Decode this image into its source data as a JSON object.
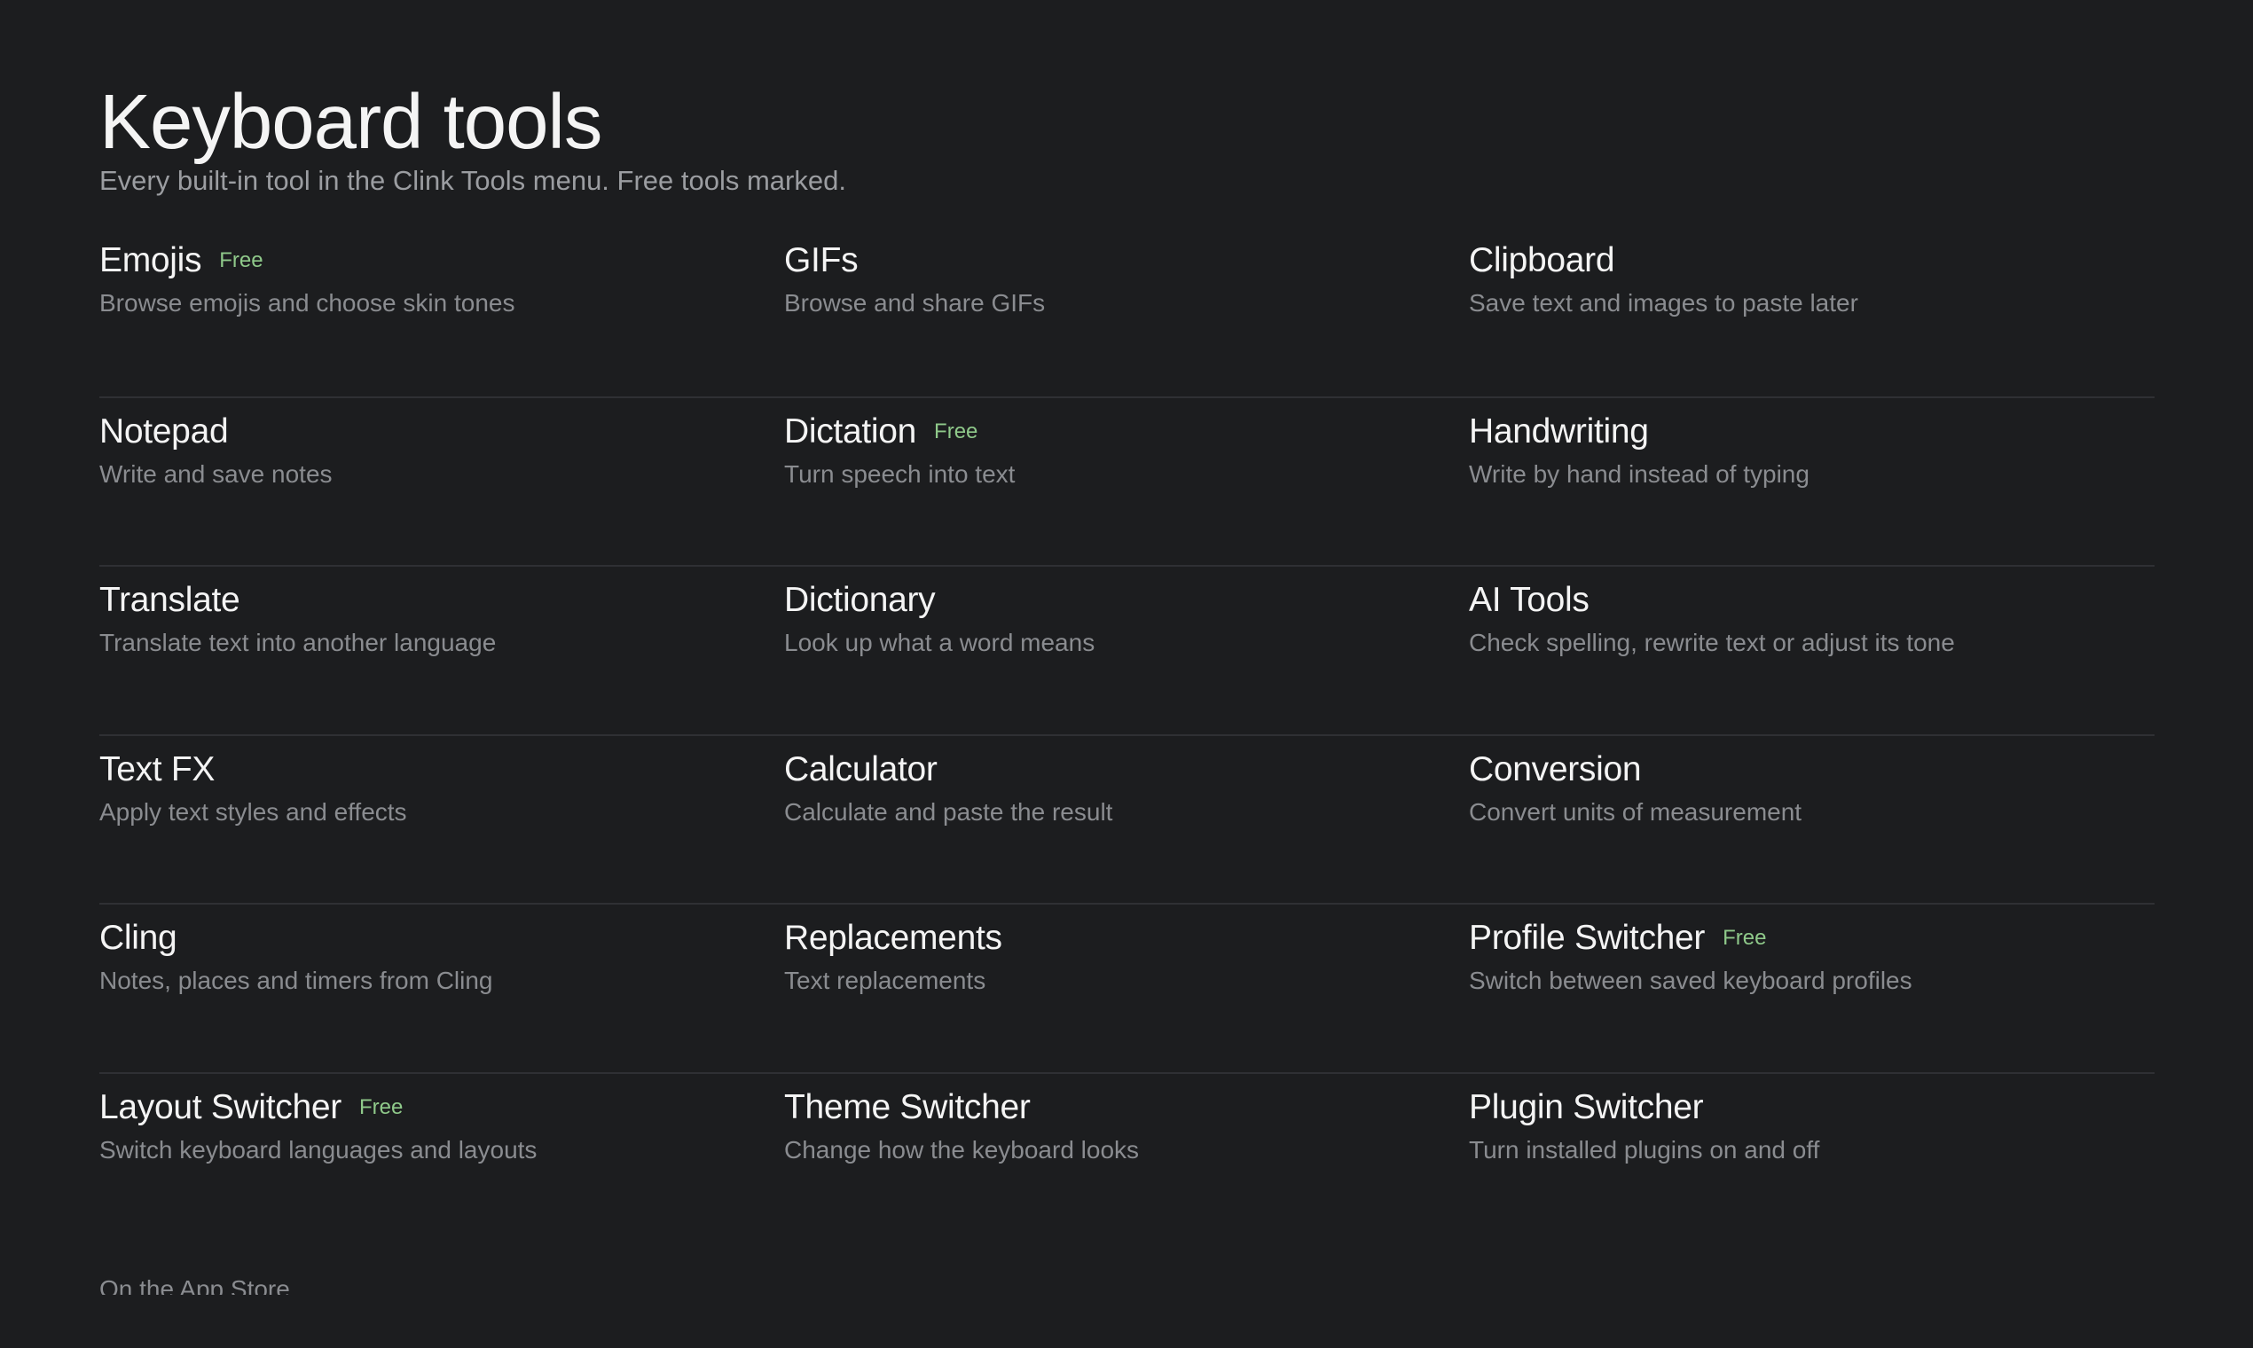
{
  "header": {
    "title": "Keyboard tools",
    "subtitle": "Every built-in tool in the Clink Tools menu. Free tools marked."
  },
  "badge_label": "Free",
  "colors": {
    "background": "#1c1d1f",
    "free_badge": "#8fc98a",
    "divider": "#2f3034"
  },
  "tools": [
    {
      "name": "Emojis",
      "desc": "Browse emojis and choose skin tones",
      "free": true
    },
    {
      "name": "GIFs",
      "desc": "Browse and share GIFs",
      "free": false
    },
    {
      "name": "Clipboard",
      "desc": "Save text and images to paste later",
      "free": false
    },
    {
      "name": "Notepad",
      "desc": "Write and save notes",
      "free": false
    },
    {
      "name": "Dictation",
      "desc": "Turn speech into text",
      "free": true
    },
    {
      "name": "Handwriting",
      "desc": "Write by hand instead of typing",
      "free": false
    },
    {
      "name": "Translate",
      "desc": "Translate text into another language",
      "free": false
    },
    {
      "name": "Dictionary",
      "desc": "Look up what a word means",
      "free": false
    },
    {
      "name": "AI Tools",
      "desc": "Check spelling, rewrite text or adjust its tone",
      "free": false
    },
    {
      "name": "Text FX",
      "desc": "Apply text styles and effects",
      "free": false
    },
    {
      "name": "Calculator",
      "desc": "Calculate and paste the result",
      "free": false
    },
    {
      "name": "Conversion",
      "desc": "Convert units of measurement",
      "free": false
    },
    {
      "name": "Cling",
      "desc": "Notes, places and timers from Cling",
      "free": false
    },
    {
      "name": "Replacements",
      "desc": "Text replacements",
      "free": false
    },
    {
      "name": "Profile Switcher",
      "desc": "Switch between saved keyboard profiles",
      "free": true
    },
    {
      "name": "Layout Switcher",
      "desc": "Switch keyboard languages and layouts",
      "free": true
    },
    {
      "name": "Theme Switcher",
      "desc": "Change how the keyboard looks",
      "free": false
    },
    {
      "name": "Plugin Switcher",
      "desc": "Turn installed plugins on and off",
      "free": false
    }
  ],
  "footer": {
    "text": "On the App Store"
  }
}
